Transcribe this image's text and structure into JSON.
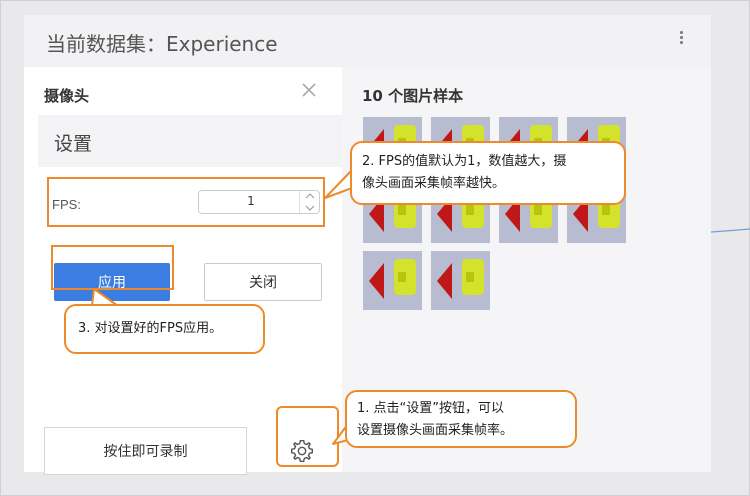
{
  "header": {
    "title": "当前数据集：Experience"
  },
  "left_panel": {
    "title": "摄像头",
    "settings_heading": "设置",
    "fps_label": "FPS:",
    "fps_value": "1",
    "apply_label": "应用",
    "close_label": "关闭",
    "record_label": "按住即可录制"
  },
  "right_panel": {
    "title": "10 个图片样本",
    "sample_count": 10
  },
  "annotations": {
    "callout_1": [
      "1. 点击“设置”按钮，可以",
      "设置摄像头画面采集帧率。"
    ],
    "callout_2": [
      "2. FPS的值默认为1，数值越大，摄",
      "像头画面采集帧率越快。"
    ],
    "callout_3": "3. 对设置好的FPS应用。"
  },
  "colors": {
    "accent": "#3b7de0",
    "annotation": "#ee8a2c"
  },
  "icons": {
    "close": "close-icon",
    "menu": "kebab-menu-icon",
    "settings": "gear-icon",
    "spinner_up": "chevron-up-icon",
    "spinner_down": "chevron-down-icon"
  }
}
